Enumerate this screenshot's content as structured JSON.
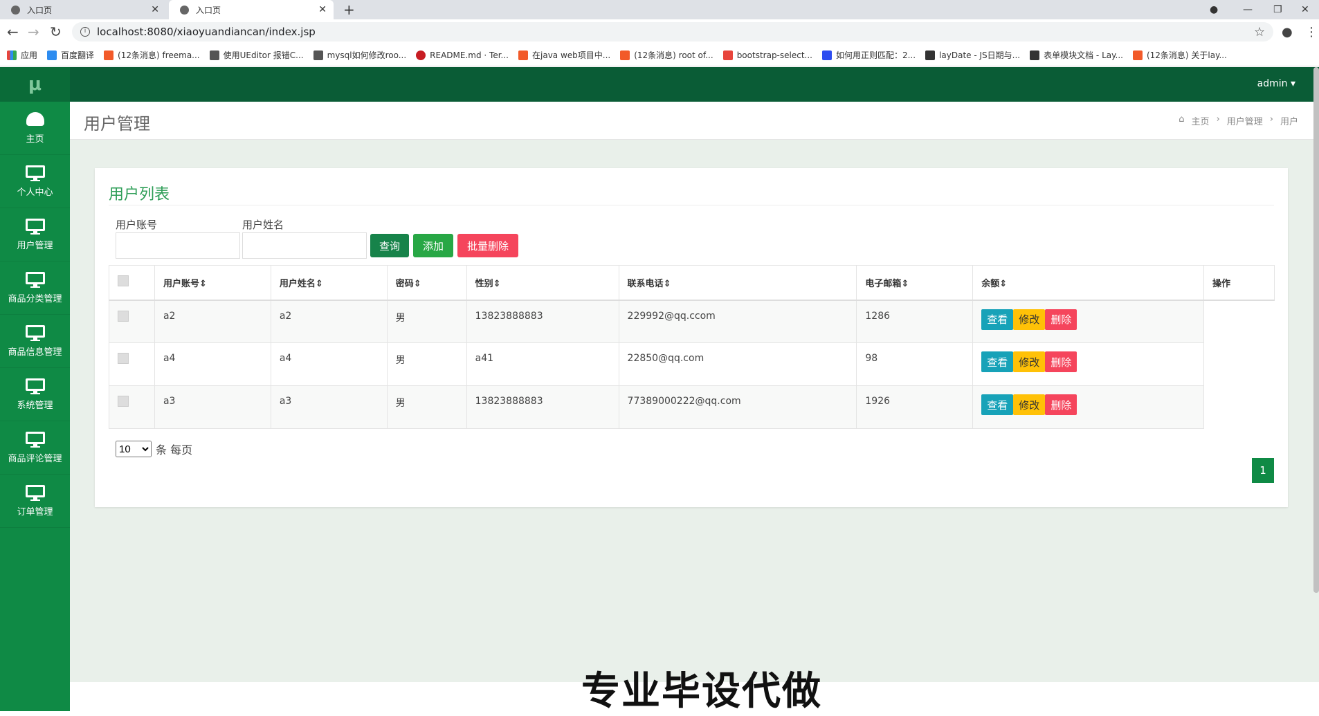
{
  "browser": {
    "tabs": [
      {
        "title": "入口页"
      },
      {
        "title": "入口页"
      }
    ],
    "url": "localhost:8080/xiaoyuandiancan/index.jsp",
    "bookmarks": [
      {
        "label": "应用",
        "color": "#e8453c"
      },
      {
        "label": "百度翻译",
        "color": "#2d8cf0"
      },
      {
        "label": "(12条消息) freema...",
        "color": "#f25a29"
      },
      {
        "label": "使用UEditor 报错C...",
        "color": "#555555"
      },
      {
        "label": "mysql如何修改roo...",
        "color": "#555555"
      },
      {
        "label": "README.md · Ter...",
        "color": "#c71d23"
      },
      {
        "label": "在java web项目中...",
        "color": "#f25a29"
      },
      {
        "label": "(12条消息) root of...",
        "color": "#f25a29"
      },
      {
        "label": "bootstrap-select...",
        "color": "#e8453c"
      },
      {
        "label": "如何用正则匹配：2...",
        "color": "#2d4df0"
      },
      {
        "label": "layDate - JS日期与...",
        "color": "#333333"
      },
      {
        "label": "表单模块文档 - Lay...",
        "color": "#333333"
      },
      {
        "label": "(12条消息) 关于lay...",
        "color": "#f25a29"
      }
    ]
  },
  "app": {
    "logo": "μ",
    "user": "admin ▾",
    "sidebar": [
      {
        "label": "主页",
        "icon": "dashboard-icon"
      },
      {
        "label": "个人中心",
        "icon": "monitor-icon"
      },
      {
        "label": "用户管理",
        "icon": "monitor-icon"
      },
      {
        "label": "商品分类管理",
        "icon": "monitor-icon"
      },
      {
        "label": "商品信息管理",
        "icon": "monitor-icon"
      },
      {
        "label": "系统管理",
        "icon": "monitor-icon"
      },
      {
        "label": "商品评论管理",
        "icon": "monitor-icon"
      },
      {
        "label": "订单管理",
        "icon": "monitor-icon"
      }
    ],
    "page_title": "用户管理",
    "breadcrumb": [
      "主页",
      "用户管理",
      "用户"
    ],
    "card_title": "用户列表",
    "filters": {
      "account_label": "用户账号",
      "name_label": "用户姓名",
      "account_value": "",
      "name_value": ""
    },
    "buttons": {
      "search": "查询",
      "add": "添加",
      "batch_delete": "批量删除"
    },
    "table": {
      "headers": [
        "用户账号",
        "用户姓名",
        "密码",
        "性别",
        "联系电话",
        "电子邮箱",
        "余额",
        "操作"
      ],
      "rows": [
        {
          "account": "a2",
          "name": "a2",
          "password": "男",
          "gender": "13823888883",
          "phone": "229992@qq.ccom",
          "email": "1286",
          "balance": ""
        },
        {
          "account": "a4",
          "name": "a4",
          "password": "男",
          "gender": "a41",
          "phone": "22850@qq.com",
          "email": "98",
          "balance": ""
        },
        {
          "account": "a3",
          "name": "a3",
          "password": "男",
          "gender": "13823888883",
          "phone": "77389000222@qq.com",
          "email": "1926",
          "balance": ""
        }
      ],
      "row_actions": {
        "view": "查看",
        "edit": "修改",
        "delete": "删除"
      }
    },
    "pagination": {
      "per_page_value": "10",
      "per_page_suffix": "条 每页",
      "current_page": "1"
    },
    "watermark": "专业毕设代做"
  },
  "colors": {
    "sidebar": "#0f8a45",
    "topbar": "#0a5c36",
    "accent_green": "#2e9e57",
    "btn_search": "#17834a",
    "btn_add": "#28a745",
    "btn_delete": "#f5455c",
    "btn_view": "#17a2b8",
    "btn_edit": "#ffc107",
    "btn_remove": "#f5455c"
  }
}
